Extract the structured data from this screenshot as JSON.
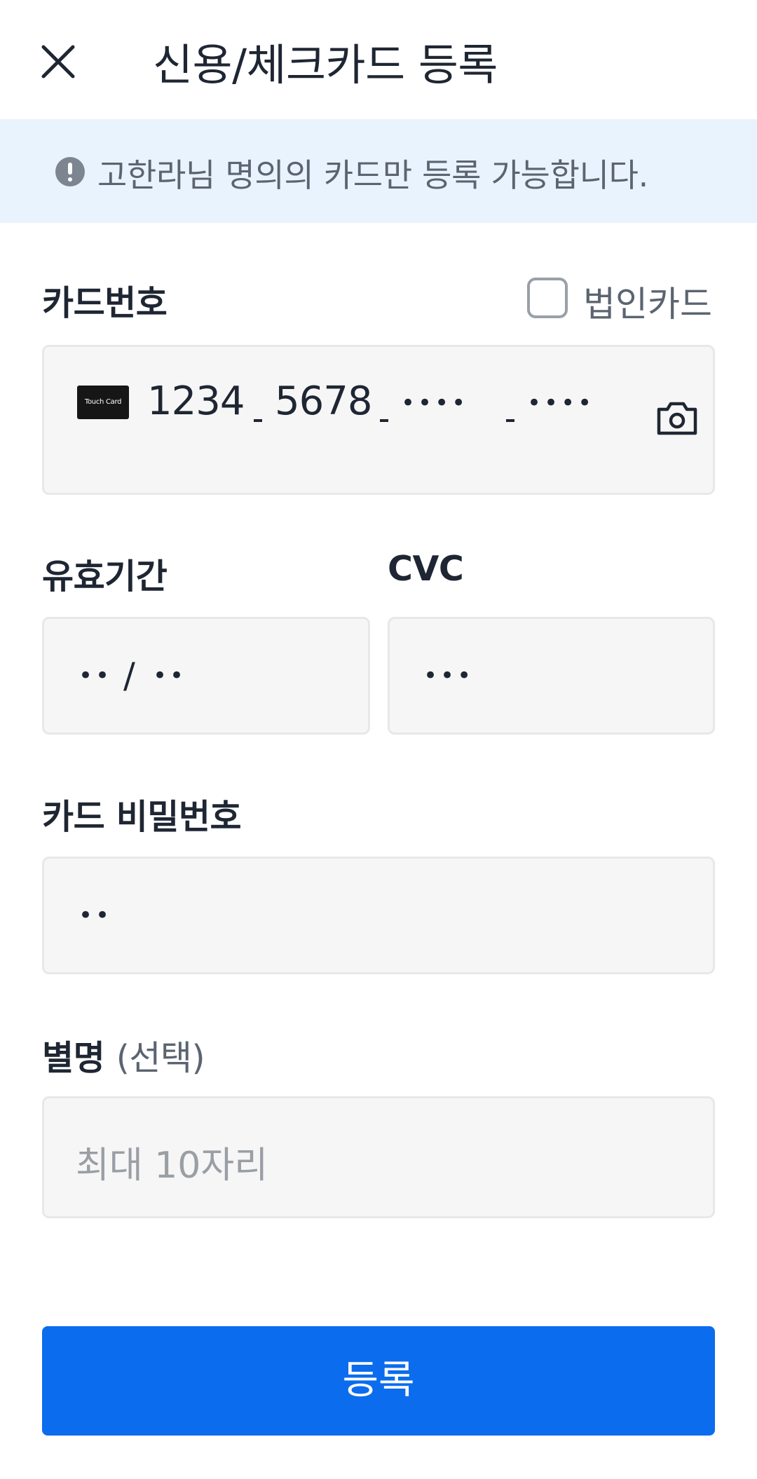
{
  "header": {
    "close_icon": "close-icon",
    "title": "신용/체크카드 등록"
  },
  "notice": {
    "icon": "exclamation-circle-icon",
    "text": "고한라님 명의의 카드만 등록 가능합니다."
  },
  "card_number": {
    "label": "카드번호",
    "corporate_checkbox_label": "법인카드",
    "corporate_checked": false,
    "card_logo_text": "Touch Card",
    "segments": [
      "1234",
      "5678",
      "••••",
      "••••"
    ],
    "camera_icon": "camera-icon"
  },
  "expiry": {
    "label": "유효기간",
    "month_value": "••",
    "separator": "/",
    "year_value": "••"
  },
  "cvc": {
    "label": "CVC",
    "value": "•••"
  },
  "card_password": {
    "label": "카드 비밀번호",
    "value": "••"
  },
  "nickname": {
    "label": "별명",
    "label_optional": "(선택)",
    "placeholder": "최대 10자리"
  },
  "submit": {
    "label": "등록"
  },
  "colors": {
    "primary": "#0c6cee",
    "notice_bg": "#e9f3fd",
    "field_bg": "#f6f6f6",
    "text": "#1f2633",
    "muted": "#5b6470"
  }
}
